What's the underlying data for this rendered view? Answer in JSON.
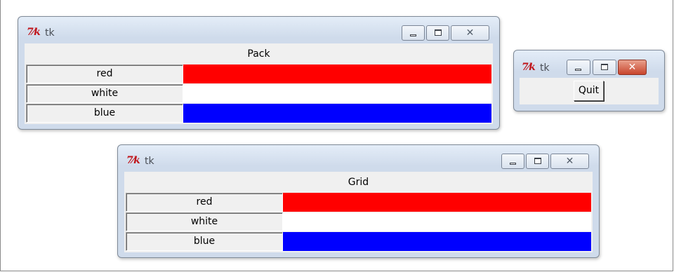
{
  "windows": {
    "pack": {
      "title": "tk",
      "icon": "tk-feather-icon",
      "heading": "Pack",
      "rows": [
        {
          "label": "red",
          "color": "#ff0000"
        },
        {
          "label": "white",
          "color": "#ffffff"
        },
        {
          "label": "blue",
          "color": "#0000ff"
        }
      ]
    },
    "quit": {
      "title": "tk",
      "icon": "tk-feather-icon",
      "button_label": "Quit"
    },
    "grid": {
      "title": "tk",
      "icon": "tk-feather-icon",
      "heading": "Grid",
      "rows": [
        {
          "label": "red",
          "color": "#ff0000"
        },
        {
          "label": "white",
          "color": "#ffffff"
        },
        {
          "label": "blue",
          "color": "#0000ff"
        }
      ]
    }
  },
  "icons": {
    "tk_logo": "7⁄k"
  }
}
